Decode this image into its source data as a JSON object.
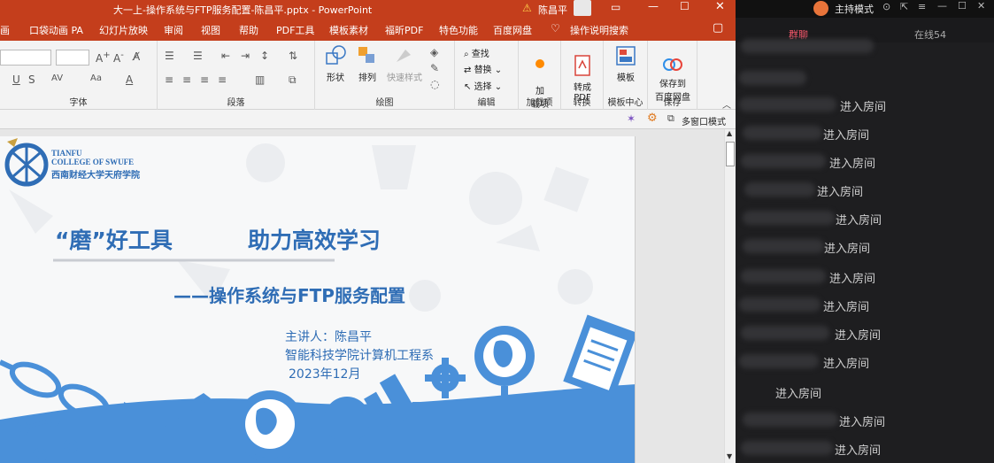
{
  "powerpoint": {
    "title": "大一上-操作系统与FTP服务配置-陈昌平.pptx - PowerPoint",
    "user": "陈昌平",
    "tabs": [
      "画",
      "口袋动画 PA",
      "幻灯片放映",
      "审阅",
      "视图",
      "帮助",
      "PDF工具",
      "模板素材",
      "福昕PDF",
      "特色功能",
      "百度网盘",
      "操作说明搜索"
    ],
    "groups": {
      "font": "字体",
      "paragraph": "段落",
      "drawing": "绘图",
      "editing": "编辑",
      "addins": "加载项",
      "convert": "转换",
      "template_center": "模板中心",
      "save": "保存"
    },
    "buttons": {
      "shape": "形状",
      "arrange": "排列",
      "quick_style": "快速样式",
      "find": "查找",
      "replace": "替换",
      "select": "选择",
      "addin": "加\n载项",
      "to_pdf": "转成\nPDF",
      "template": "模板",
      "save_baidu": "保存到\n百度网盘"
    },
    "multi_window": "多窗口模式"
  },
  "slide": {
    "school_en1": "TIANFU",
    "school_en2": "COLLEGE OF SWUFE",
    "school_cn": "西南财经大学天府学院",
    "headline_left": "“磨”好工具",
    "headline_right": "助力高效学习",
    "subtitle": "——操作系统与FTP服务配置",
    "speaker": "主讲人：陈昌平",
    "department": "智能科技学院计算机工程系",
    "date": "2023年12月"
  },
  "panel": {
    "host_mode": "主持模式",
    "tab_group": "群聊",
    "tab_online": "在线54",
    "join_text": "进入房间",
    "entry_count": 12
  },
  "colors": {
    "ppt_red": "#c43e1c",
    "slide_blue": "#2f6db5",
    "icon_blue": "#4a90d9",
    "panel_bg": "#1e1e20",
    "accent_pink": "#ff5a6e"
  }
}
